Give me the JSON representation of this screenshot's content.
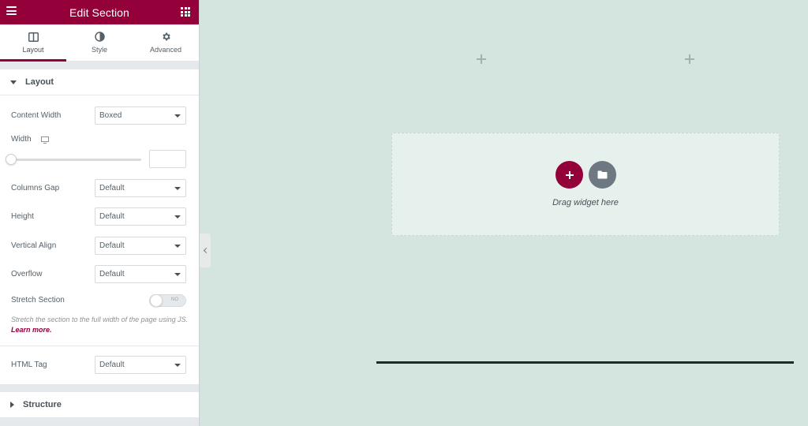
{
  "panel": {
    "title": "Edit Section",
    "tabs": [
      {
        "label": "Layout",
        "icon": "columns-icon",
        "active": true
      },
      {
        "label": "Style",
        "icon": "contrast-icon",
        "active": false
      },
      {
        "label": "Advanced",
        "icon": "gear-icon",
        "active": false
      }
    ],
    "layout_section": {
      "title": "Layout",
      "expanded": true,
      "content_width": {
        "label": "Content Width",
        "value": "Boxed"
      },
      "width": {
        "label": "Width",
        "device_icon": "desktop-icon",
        "value": ""
      },
      "columns_gap": {
        "label": "Columns Gap",
        "value": "Default"
      },
      "height": {
        "label": "Height",
        "value": "Default"
      },
      "vertical_align": {
        "label": "Vertical Align",
        "value": "Default"
      },
      "overflow": {
        "label": "Overflow",
        "value": "Default"
      },
      "stretch_section": {
        "label": "Stretch Section",
        "toggle_text": "NO",
        "enabled": false,
        "description": "Stretch the section to the full width of the page using JS.",
        "link_text": "Learn more."
      },
      "html_tag": {
        "label": "HTML Tag",
        "value": "Default"
      }
    },
    "structure_section": {
      "title": "Structure",
      "expanded": false
    }
  },
  "canvas": {
    "dropzone_text": "Drag widget here"
  },
  "colors": {
    "accent": "#93003a",
    "canvas_bg": "#d4e4de",
    "folder_button": "#6d7882"
  }
}
